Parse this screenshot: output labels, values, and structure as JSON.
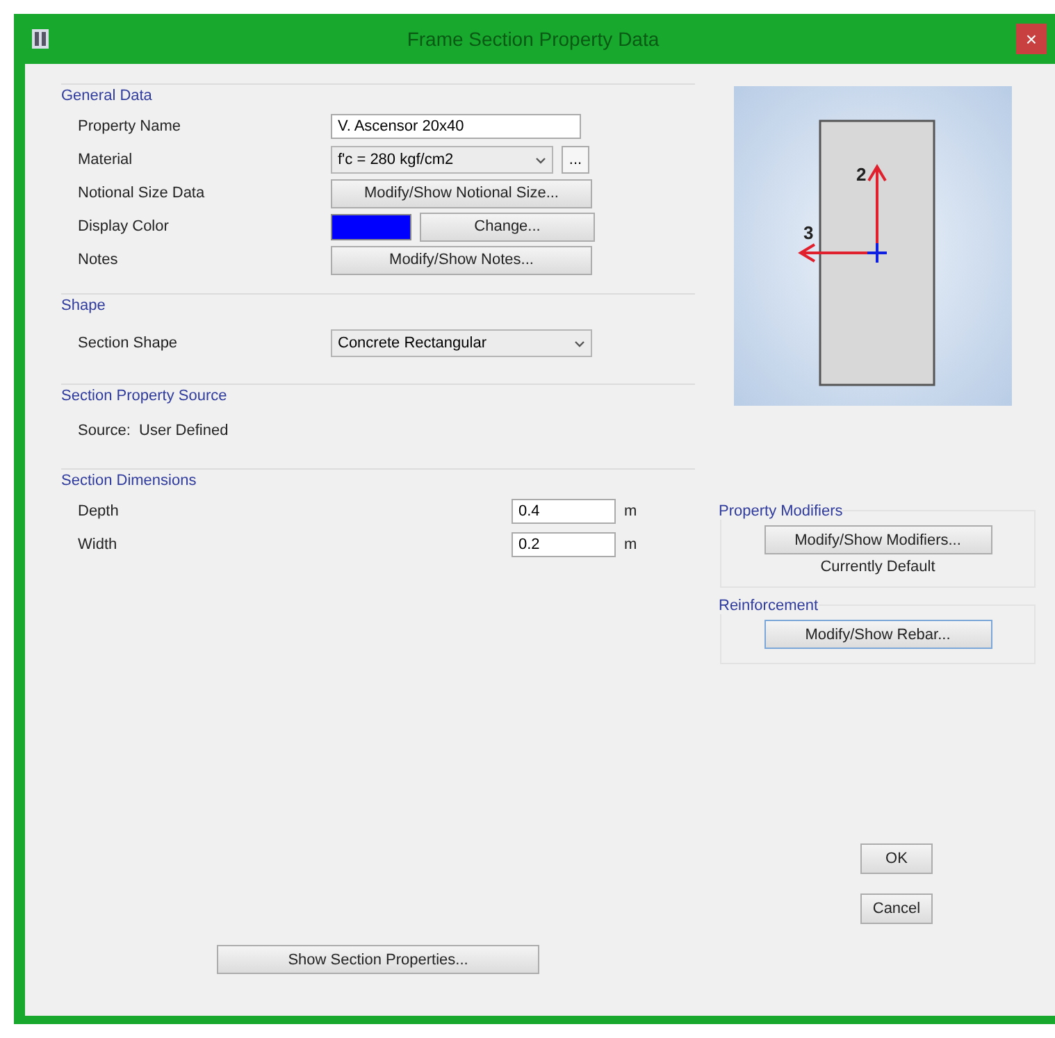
{
  "window": {
    "title": "Frame Section Property Data",
    "close": "×"
  },
  "general_data": {
    "title": "General Data",
    "rows": [
      {
        "kind": "text",
        "label": "Property Name",
        "value": "V. Ascensor 20x40"
      },
      {
        "kind": "dropdown",
        "label": "Material",
        "value": "f'c = 280 kgf/cm2",
        "extra": "..."
      },
      {
        "kind": "button",
        "label": "Notional Size Data",
        "button": "Modify/Show Notional Size..."
      },
      {
        "kind": "color",
        "label": "Display Color",
        "color": "#0000ff",
        "button": "Change..."
      },
      {
        "kind": "button",
        "label": "Notes",
        "button": "Modify/Show Notes..."
      }
    ]
  },
  "shape": {
    "title": "Shape",
    "label": "Section Shape",
    "value": "Concrete Rectangular"
  },
  "source": {
    "title": "Section Property Source",
    "text": "Source:  User Defined"
  },
  "dimensions": {
    "title": "Section Dimensions",
    "rows": [
      {
        "label": "Depth",
        "value": "0.4",
        "unit": "m"
      },
      {
        "label": "Width",
        "value": "0.2",
        "unit": "m"
      }
    ],
    "button": "Show Section Properties..."
  },
  "preview": {
    "axis_2": "2",
    "axis_3": "3"
  },
  "property_modifiers": {
    "title": "Property Modifiers",
    "button": "Modify/Show Modifiers...",
    "status": "Currently Default"
  },
  "reinforcement": {
    "title": "Reinforcement",
    "button": "Modify/Show Rebar..."
  },
  "buttons": [
    "OK",
    "Cancel"
  ]
}
